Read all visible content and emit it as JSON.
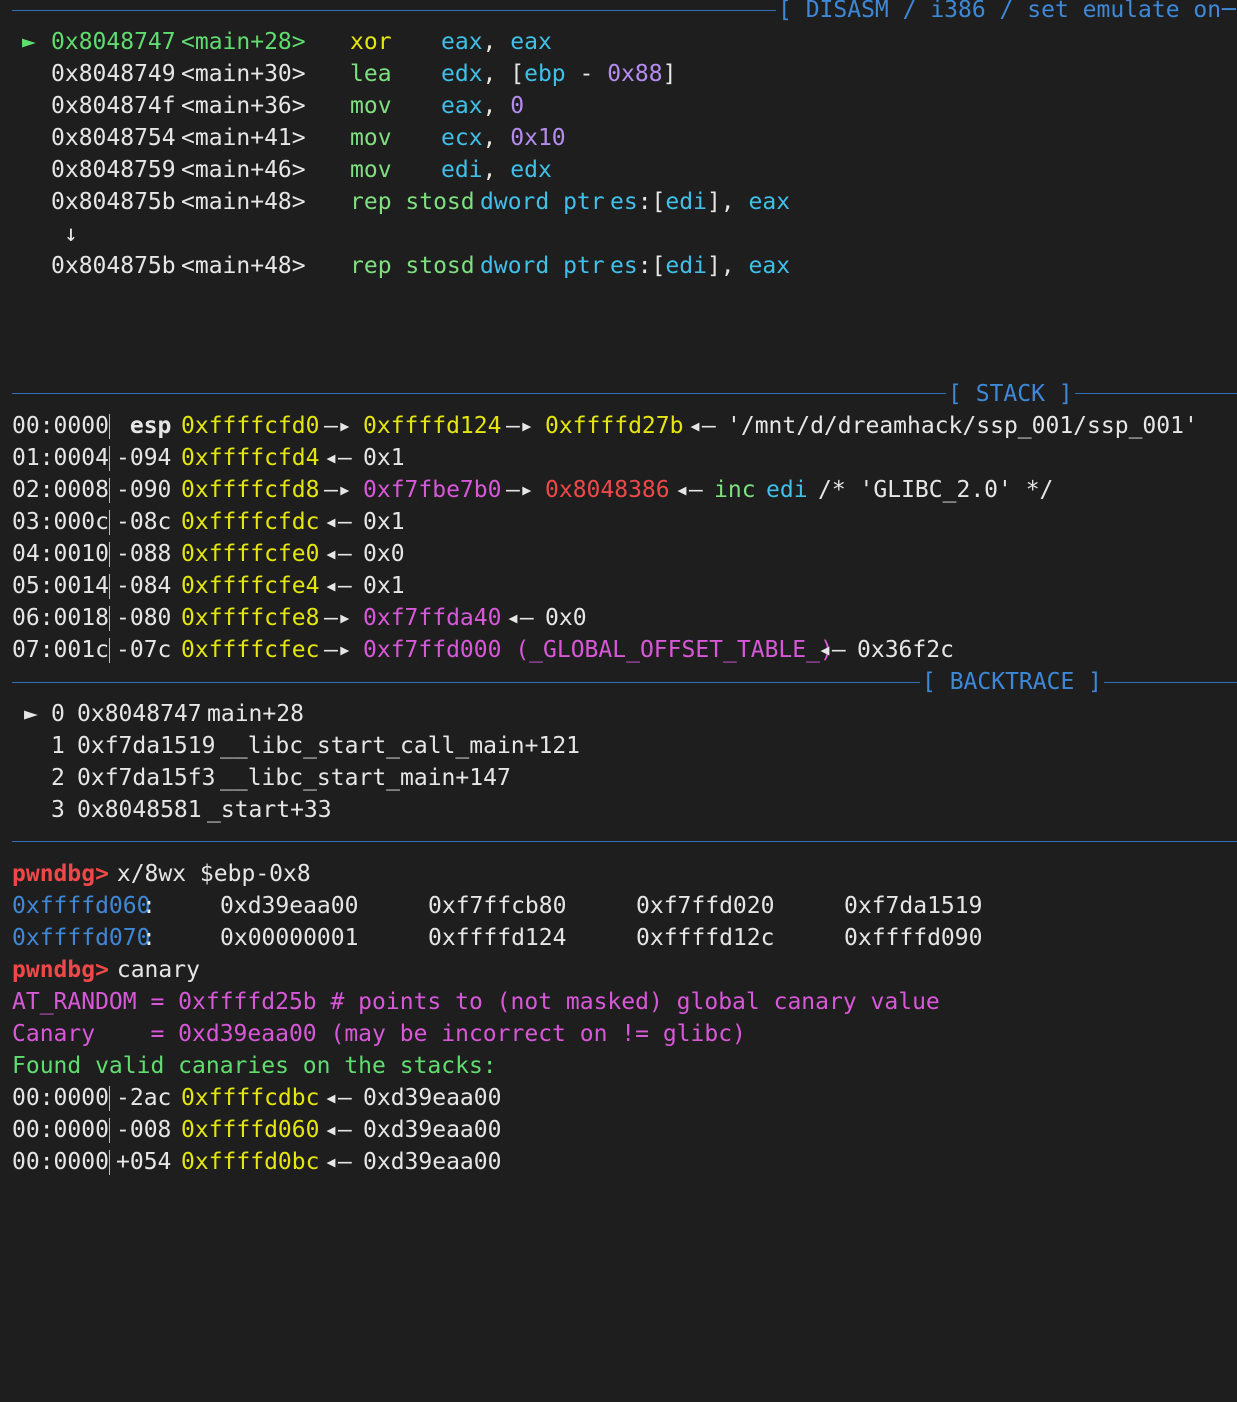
{
  "headers": {
    "disasm": "[ DISASM / i386 / set emulate on ]",
    "stack": "[ STACK ]",
    "backtrace": "[ BACKTRACE ]"
  },
  "disasm": [
    {
      "marker": "►",
      "addr": "0x8048747",
      "sym": "<main+28>",
      "mnem": "xor",
      "op1": "eax",
      "sep": ", ",
      "op2": "eax",
      "current": true
    },
    {
      "marker": "",
      "addr": "0x8048749",
      "sym": "<main+30>",
      "mnem": "lea",
      "op1": "edx",
      "sep": ", [",
      "op2": "ebp",
      "op3": " - ",
      "op4": "0x88",
      "op5": "]"
    },
    {
      "marker": "",
      "addr": "0x804874f",
      "sym": "<main+36>",
      "mnem": "mov",
      "op1": "eax",
      "sep": ", ",
      "op2": "0"
    },
    {
      "marker": "",
      "addr": "0x8048754",
      "sym": "<main+41>",
      "mnem": "mov",
      "op1": "ecx",
      "sep": ", ",
      "op2": "0x10"
    },
    {
      "marker": "",
      "addr": "0x8048759",
      "sym": "<main+46>",
      "mnem": "mov",
      "op1": "edi",
      "sep": ", ",
      "op2": "edx"
    },
    {
      "marker": "",
      "addr": "0x804875b",
      "sym": "<main+48>",
      "mnem": "rep stosd",
      "op1": "dword ptr",
      "es": "es",
      "sep": ":[",
      "op2": "edi",
      "op3": "], ",
      "op4": "eax"
    }
  ],
  "disasm_arrow": "↓",
  "disasm_after": {
    "addr": "0x804875b",
    "sym": "<main+48>",
    "mnem": "rep stosd",
    "op1": "dword ptr",
    "es": "es",
    "sep": ":[",
    "op2": "edi",
    "op3": "], ",
    "op4": "eax"
  },
  "stack": [
    {
      "idx": "00:0000",
      "off": " esp",
      "addr": "0xffffcfd0",
      "a1": "—▸",
      "p1": "0xffffd124",
      "a2": "—▸",
      "p2": "0xffffd27b",
      "a3": "◂—",
      "val": "'/mnt/d/dreamhack/ssp_001/ssp_001'"
    },
    {
      "idx": "01:0004",
      "off": "-094",
      "addr": "0xffffcfd4",
      "a1": "◂—",
      "val": "0x1"
    },
    {
      "idx": "02:0008",
      "off": "-090",
      "addr": "0xffffcfd8",
      "a1": "—▸",
      "p1": "0xf7fbe7b0",
      "a2": "—▸",
      "p2": "0x8048386",
      "a3": "◂—",
      "ins1": "inc",
      "ins2": "edi",
      "val": "/* 'GLIBC_2.0' */"
    },
    {
      "idx": "03:000c",
      "off": "-08c",
      "addr": "0xffffcfdc",
      "a1": "◂—",
      "val": "0x1"
    },
    {
      "idx": "04:0010",
      "off": "-088",
      "addr": "0xffffcfe0",
      "a1": "◂—",
      "val": "0x0"
    },
    {
      "idx": "05:0014",
      "off": "-084",
      "addr": "0xffffcfe4",
      "a1": "◂—",
      "val": "0x1"
    },
    {
      "idx": "06:0018",
      "off": "-080",
      "addr": "0xffffcfe8",
      "a1": "—▸",
      "p1": "0xf7ffda40",
      "a2": "◂—",
      "val": "0x0"
    },
    {
      "idx": "07:001c",
      "off": "-07c",
      "addr": "0xffffcfec",
      "a1": "—▸",
      "p1": "0xf7ffd000 (_GLOBAL_OFFSET_TABLE_)",
      "a2": "◂—",
      "val": "0x36f2c"
    }
  ],
  "backtrace": [
    {
      "marker": "►",
      "n": "0",
      "addr": "0x8048747",
      "sym": "main+28"
    },
    {
      "marker": "",
      "n": "1",
      "addr": "0xf7da1519",
      "sym": "__libc_start_call_main+121"
    },
    {
      "marker": "",
      "n": "2",
      "addr": "0xf7da15f3",
      "sym": "__libc_start_main+147"
    },
    {
      "marker": "",
      "n": "3",
      "addr": "0x8048581",
      "sym": "_start+33"
    }
  ],
  "console": {
    "prompt": "pwndbg>",
    "cmd1": " x/8wx $ebp-0x8",
    "mem": [
      {
        "addr": "0xffffd060",
        "colon": ":",
        "w": [
          "0xd39eaa00",
          "0xf7ffcb80",
          "0xf7ffd020",
          "0xf7da1519"
        ]
      },
      {
        "addr": "0xffffd070",
        "colon": ":",
        "w": [
          "0x00000001",
          "0xffffd124",
          "0xffffd12c",
          "0xffffd090"
        ]
      }
    ],
    "cmd2": " canary",
    "at_random": "AT_RANDOM = 0xffffd25b # points to (not masked) global canary value",
    "canary": "Canary    = 0xd39eaa00 (may be incorrect on != glibc)",
    "found": "Found valid canaries on the stacks:",
    "canaries": [
      {
        "idx": "00:0000",
        "off": "-2ac",
        "addr": "0xffffcdbc",
        "arrow": "◂—",
        "val": "0xd39eaa00"
      },
      {
        "idx": "00:0000",
        "off": "-008",
        "addr": "0xffffd060",
        "arrow": "◂—",
        "val": "0xd39eaa00"
      },
      {
        "idx": "00:0000",
        "off": "+054",
        "addr": "0xffffd0bc",
        "arrow": "◂—",
        "val": "0xd39eaa00"
      }
    ]
  }
}
